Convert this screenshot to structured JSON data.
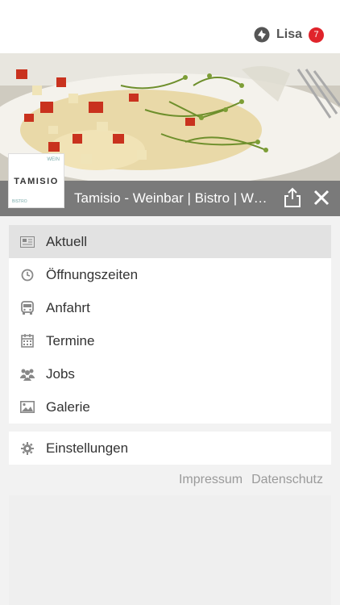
{
  "user": {
    "name": "Lisa",
    "notifications": "7"
  },
  "app": {
    "title": "Tamisio - Weinbar | Bistro | Weinhandel",
    "logo_text": "TAMISIO",
    "logo_top": "WEIN",
    "logo_bottom": "BISTRO"
  },
  "menu": {
    "items": [
      {
        "label": "Aktuell",
        "icon": "newspaper-icon"
      },
      {
        "label": "Öffnungszeiten",
        "icon": "clock-icon"
      },
      {
        "label": "Anfahrt",
        "icon": "bus-icon"
      },
      {
        "label": "Termine",
        "icon": "calendar-icon"
      },
      {
        "label": "Jobs",
        "icon": "people-icon"
      },
      {
        "label": "Galerie",
        "icon": "image-icon"
      }
    ],
    "settings": {
      "label": "Einstellungen",
      "icon": "gear-icon"
    }
  },
  "footer": {
    "impressum": "Impressum",
    "datenschutz": "Datenschutz"
  },
  "colors": {
    "badge": "#e0242b",
    "titlebar": "#7a7a7a",
    "active": "#e2e2e2"
  }
}
